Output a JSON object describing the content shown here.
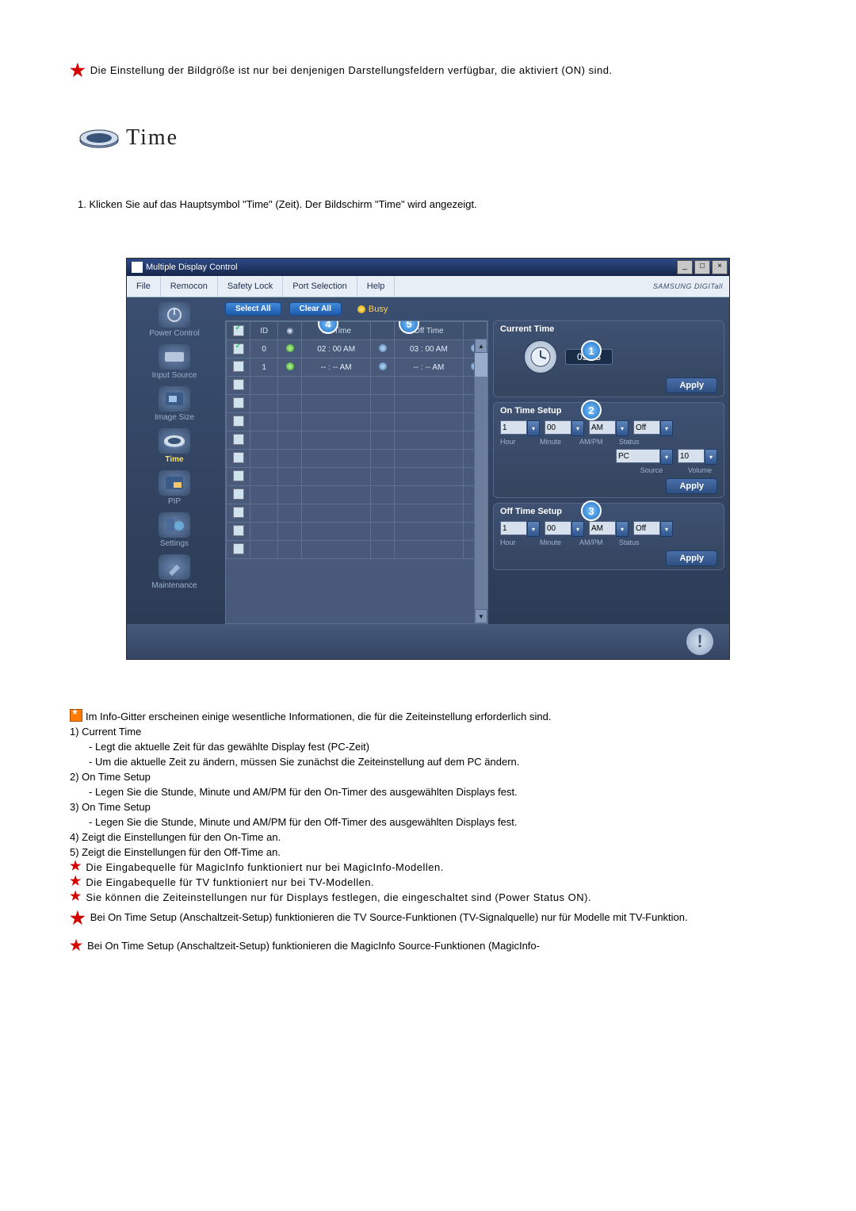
{
  "top_note": "Die Einstellung der Bildgröße ist nur bei denjenigen Darstellungsfeldern verfügbar, die aktiviert (ON) sind.",
  "heading": "Time",
  "step1": "1.  Klicken Sie auf das Hauptsymbol \"Time\" (Zeit). Der Bildschirm \"Time\" wird angezeigt.",
  "app": {
    "title": "Multiple Display Control",
    "menu": {
      "file": "File",
      "remocon": "Remocon",
      "safety": "Safety Lock",
      "port": "Port Selection",
      "help": "Help"
    },
    "brand": "SAMSUNG DIGITall",
    "sidebar": {
      "power": "Power Control",
      "input": "Input Source",
      "image": "Image Size",
      "time": "Time",
      "pip": "PIP",
      "settings": "Settings",
      "maint": "Maintenance"
    },
    "buttons": {
      "select_all": "Select All",
      "clear_all": "Clear All",
      "busy": "Busy",
      "apply": "Apply"
    },
    "grid": {
      "id_h": "ID",
      "ontime_h": "On Time",
      "offtime_h": "Off Time",
      "rows": [
        {
          "id": "0",
          "on": "02 : 00 AM",
          "off": "03 : 00 AM",
          "st": true
        },
        {
          "id": "1",
          "on": "-- : -- AM",
          "off": "-- : -- AM",
          "st": true
        }
      ]
    },
    "panels": {
      "current": "Current Time",
      "current_val": "05:23",
      "onsetup": "On Time Setup",
      "offsetup": "Off Time Setup",
      "hour": "Hour",
      "minute": "Minute",
      "ampm": "AM/PM",
      "status": "Status",
      "source": "Source",
      "volume": "Volume",
      "h_v": "1",
      "m_v": "00",
      "ampm_v": "AM",
      "st_v": "Off",
      "src_v": "PC",
      "vol_v": "10"
    }
  },
  "body": {
    "intro": "Im Info-Gitter erscheinen einige wesentliche Informationen, die für die Zeiteinstellung erforderlich sind.",
    "l1": "1)  Current Time",
    "l1a": "- Legt die aktuelle Zeit für das gewählte Display fest (PC-Zeit)",
    "l1b": "- Um die aktuelle Zeit zu ändern, müssen Sie zunächst die Zeiteinstellung auf dem PC ändern.",
    "l2": "2)  On Time Setup",
    "l2a": "- Legen Sie die Stunde, Minute und AM/PM für den On-Timer des ausgewählten Displays fest.",
    "l3": "3)  On Time Setup",
    "l3a": "- Legen Sie die Stunde, Minute und AM/PM für den Off-Timer des ausgewählten Displays fest.",
    "l4": "4)  Zeigt die Einstellungen für den On-Time an.",
    "l5": "5)  Zeigt die Einstellungen für den Off-Time an.",
    "n1": "Die Eingabequelle für MagicInfo funktioniert nur bei MagicInfo-Modellen.",
    "n2": "Die Eingabequelle für TV funktioniert nur bei TV-Modellen.",
    "n3": "Sie können die Zeiteinstellungen nur für Displays festlegen, die eingeschaltet sind (Power Status ON).",
    "n4": "Bei On Time Setup (Anschaltzeit-Setup) funktionieren die TV Source-Funktionen (TV-Signalquelle) nur für Modelle mit TV-Funktion.",
    "n5": "Bei On Time Setup (Anschaltzeit-Setup) funktionieren die MagicInfo Source-Funktionen (MagicInfo-"
  }
}
